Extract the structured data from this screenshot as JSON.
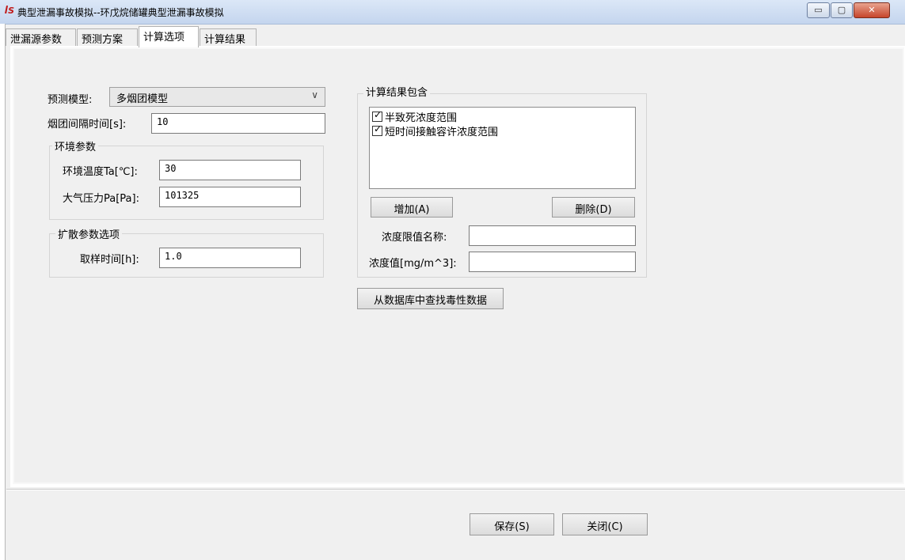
{
  "window": {
    "app_icon": "ꟾS",
    "title": "典型泄漏事故模拟--环戊烷储罐典型泄漏事故模拟",
    "min_glyph": "▭",
    "max_glyph": "▢",
    "close_glyph": "✕"
  },
  "tabs": [
    {
      "label": "泄漏源参数"
    },
    {
      "label": "预测方案"
    },
    {
      "label": "计算选项",
      "active": true
    },
    {
      "label": "计算结果"
    }
  ],
  "model": {
    "label": "预测模型:",
    "selected": "多烟团模型",
    "arrow": "∨"
  },
  "interval": {
    "label": "烟团间隔时间[s]:",
    "value": "10"
  },
  "env": {
    "title": "环境参数",
    "temp_label": "环境温度Ta[℃]:",
    "temp_value": "30",
    "pressure_label": "大气压力Pa[Pa]:",
    "pressure_value": "101325"
  },
  "diffusion": {
    "title": "扩散参数选项",
    "sample_label": "取样时间[h]:",
    "sample_value": "1.0"
  },
  "results": {
    "title": "计算结果包含",
    "items": [
      {
        "label": "半致死浓度范围",
        "checked": true
      },
      {
        "label": "短时间接触容许浓度范围",
        "checked": true
      }
    ],
    "add_button": "增加(A)",
    "delete_button": "删除(D)",
    "limit_name_label": "浓度限值名称:",
    "limit_name_value": "",
    "conc_label": "浓度值[mg/m^3]:",
    "conc_value": "",
    "db_button": "从数据库中查找毒性数据"
  },
  "footer": {
    "save_button": "保存(S)",
    "close_button": "关闭(C)"
  }
}
